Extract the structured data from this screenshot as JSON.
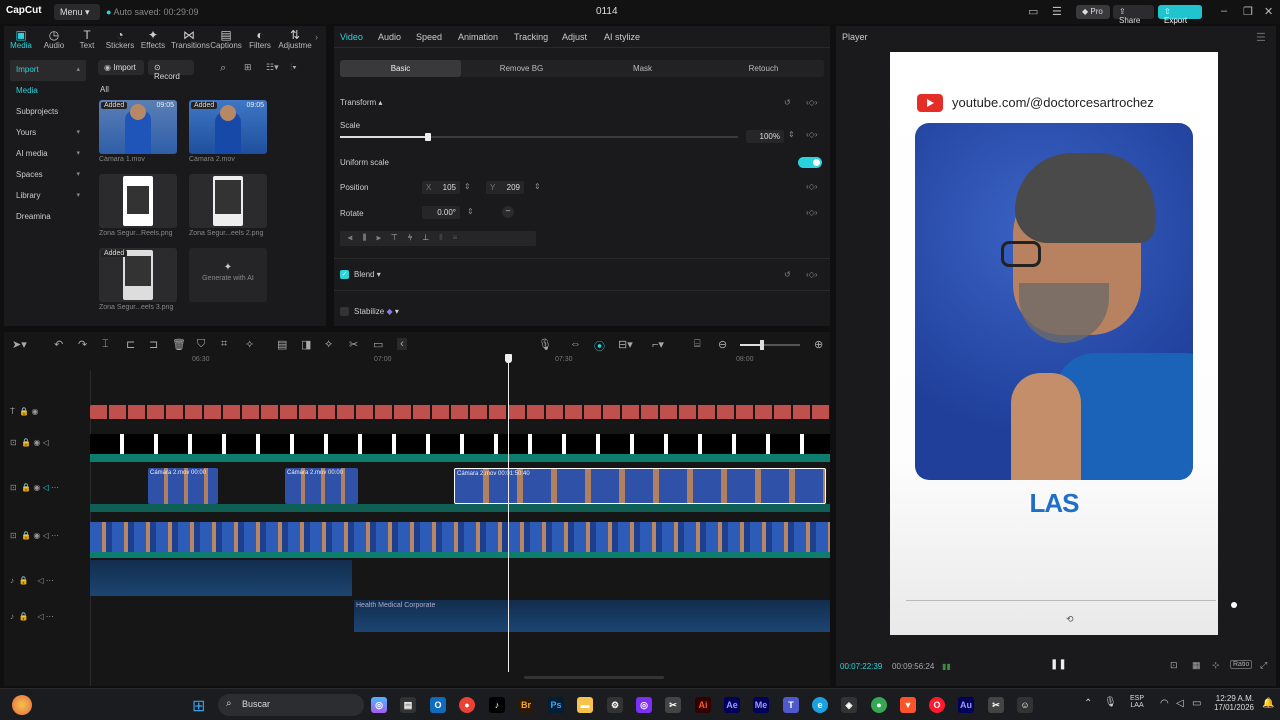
{
  "titlebar": {
    "logo": "CapCut",
    "menu_label": "Menu",
    "autosave": "Auto saved: 00:29:09",
    "title": "0114",
    "pro_label": "Pro",
    "share_label": "Share",
    "export_label": "Export"
  },
  "toolbar_tabs": [
    {
      "label": "Media",
      "icon": "media-icon",
      "active": true
    },
    {
      "label": "Audio",
      "icon": "audio-icon"
    },
    {
      "label": "Text",
      "icon": "text-icon"
    },
    {
      "label": "Stickers",
      "icon": "stickers-icon"
    },
    {
      "label": "Effects",
      "icon": "effects-icon"
    },
    {
      "label": "Transitions",
      "icon": "transitions-icon"
    },
    {
      "label": "Captions",
      "icon": "captions-icon"
    },
    {
      "label": "Filters",
      "icon": "filters-icon"
    },
    {
      "label": "Adjustme",
      "icon": "adjustment-icon"
    }
  ],
  "sidebar": {
    "items": [
      {
        "label": "Import",
        "active": true
      },
      {
        "label": "Media",
        "selected": true
      },
      {
        "label": "Subprojects"
      },
      {
        "label": "Yours"
      },
      {
        "label": "AI media"
      },
      {
        "label": "Spaces"
      },
      {
        "label": "Library"
      },
      {
        "label": "Dreamina"
      }
    ]
  },
  "media": {
    "import_label": "Import",
    "record_label": "Record",
    "filter_label": "All",
    "items": [
      {
        "name": "Cámara 1.mov",
        "duration": "09:05",
        "tag": "Added"
      },
      {
        "name": "Cámara 2.mov",
        "duration": "09:05",
        "tag": "Added"
      },
      {
        "name": "Zona Segur...Reels.png"
      },
      {
        "name": "Zona Segur...eels 2.png"
      },
      {
        "name": "Zona Segur...eels 3.png",
        "tag": "Added"
      }
    ],
    "generate_label": "Generate with AI"
  },
  "props": {
    "tabs": [
      "Video",
      "Audio",
      "Speed",
      "Animation",
      "Tracking",
      "Adjust",
      "AI stylize"
    ],
    "subtabs": [
      "Basic",
      "Remove BG",
      "Mask",
      "Retouch"
    ],
    "transform_label": "Transform",
    "scale_label": "Scale",
    "scale_value": "100%",
    "scale_fraction": 0.22,
    "uniform_label": "Uniform scale",
    "position_label": "Position",
    "pos_x_label": "X",
    "pos_x": "105",
    "pos_y_label": "Y",
    "pos_y": "209",
    "rotate_label": "Rotate",
    "rotate_value": "0.00°",
    "blend_label": "Blend",
    "stabilize_label": "Stabilize"
  },
  "player": {
    "title": "Player",
    "url_text": "youtube.com/@doctorcesartrochez",
    "caption": "LAS",
    "current_time": "00:07:22:39",
    "total_time": "00:09:56:24",
    "ratio_label": "Ratio"
  },
  "timeline": {
    "ruler": [
      "06:30",
      "07:00",
      "07:30",
      "08:00"
    ],
    "clips": [
      {
        "name": "Cámara 2.mov",
        "time": "00:00"
      },
      {
        "name": "Cámara 2.mov",
        "time": "00:00"
      },
      {
        "name": "Cámara 2.mov",
        "time": "00:01:50:40"
      }
    ],
    "audio_clip": "Health Medical Corporate"
  },
  "taskbar": {
    "search": "Buscar",
    "lang": "ESP",
    "lang2": "LAA",
    "time": "12:29 A.M.",
    "date": "17/01/2026"
  },
  "colors": {
    "accent": "#2ad4dc",
    "clip_red": "#c0504d",
    "track_teal": "#0f7c70"
  }
}
